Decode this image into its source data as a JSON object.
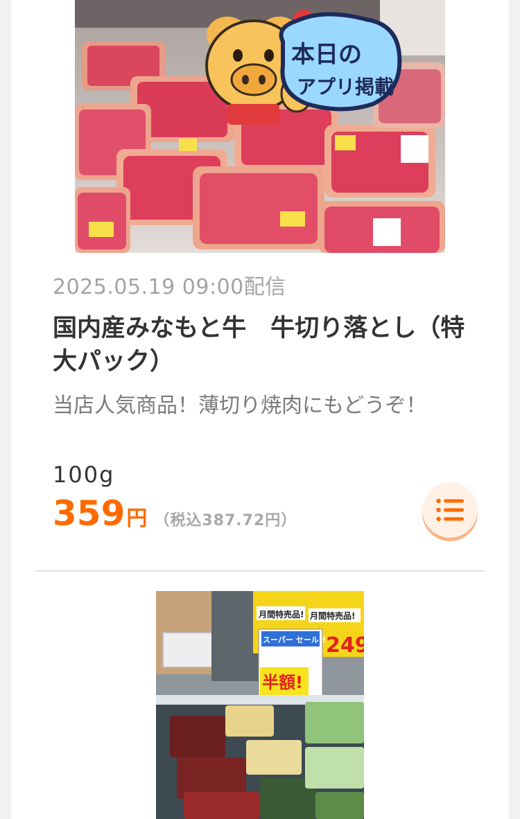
{
  "items": [
    {
      "image": {
        "sign_text_line1": "本日の",
        "sign_text_line2": "アプリ掲載"
      },
      "date": "2025.05.19 09:00配信",
      "title": "国内産みなもと牛　牛切り落とし（特大パック）",
      "subtitle": "当店人気商品！薄切り焼肉にもどうぞ！",
      "unit": "100g",
      "price": "359",
      "currency": "円",
      "tax_note": "（税込387.72円）",
      "list_icon": "list-icon"
    },
    {
      "image": {
        "sign_half_price": "半額!",
        "sign_super_sale": "スーパー セール!!",
        "sign_monthly_1": "月間特売品!",
        "sign_monthly_2": "月間特売品!",
        "sign_price": "249"
      }
    }
  ],
  "colors": {
    "accent": "#ff6a00",
    "button_bg": "#fff1e6",
    "button_shadow": "#fbb485"
  }
}
